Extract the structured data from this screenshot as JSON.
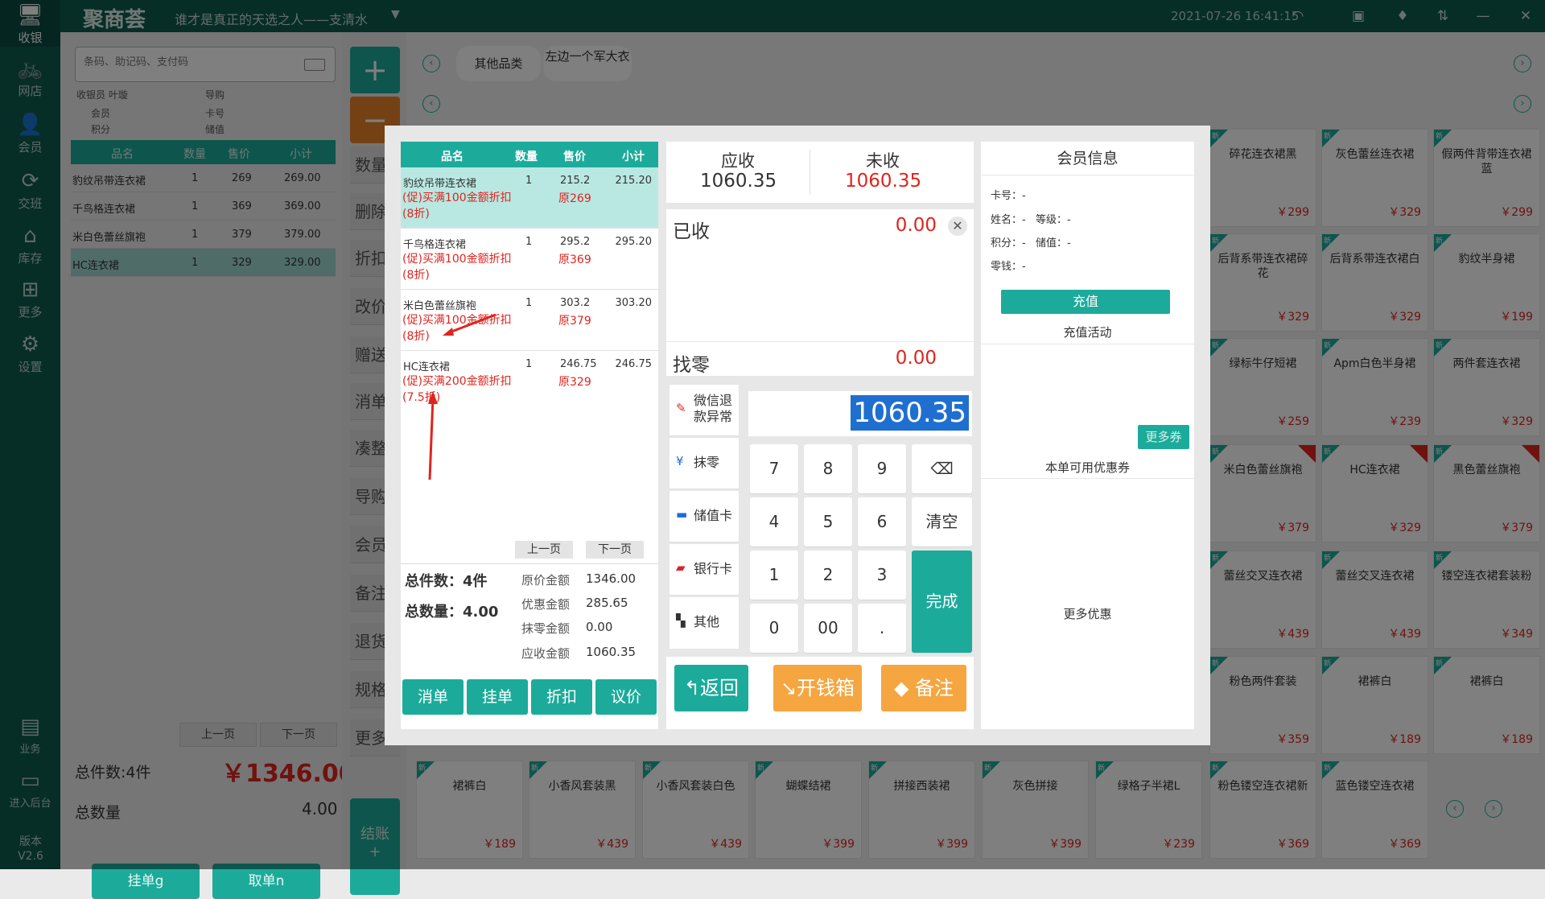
{
  "nav": [
    {
      "icon": "monitor-icon",
      "glyph": "🖥",
      "label": "收银"
    },
    {
      "icon": "bike-icon",
      "glyph": "🚲",
      "label": "网店"
    },
    {
      "icon": "user-icon",
      "glyph": "👤",
      "label": "会员"
    },
    {
      "icon": "exchange-icon",
      "glyph": "⟳",
      "label": "交班"
    },
    {
      "icon": "warehouse-icon",
      "glyph": "⌂",
      "label": "库存"
    },
    {
      "icon": "grid-icon",
      "glyph": "⊞",
      "label": "更多"
    },
    {
      "icon": "gear-icon",
      "glyph": "⚙",
      "label": "设置"
    },
    {
      "icon": "report-icon",
      "glyph": "▤",
      "label": "业务"
    },
    {
      "icon": "backend-icon",
      "glyph": "▭",
      "label": "进入后台"
    },
    {
      "icon": "",
      "glyph": "",
      "label": "版本 V2.6"
    }
  ],
  "topbar": {
    "logo": "聚商荟",
    "slogan": "谁才是真正的天选之人——支清水",
    "datetime": "2021-07-26 16:41:15"
  },
  "left": {
    "search_placeholder": "条码、助记码、支付码",
    "cashier_label": "收银员",
    "cashier": "叶璇",
    "guide_label": "导购",
    "member_label": "会员",
    "card_label": "卡号",
    "points_label": "积分",
    "stored_label": "储值",
    "columns": [
      "品名",
      "数量",
      "售价",
      "小计"
    ],
    "rows": [
      {
        "name": "豹纹吊带连衣裙",
        "qty": "1",
        "price": "269",
        "subtotal": "269.00"
      },
      {
        "name": "千鸟格连衣裙",
        "qty": "1",
        "price": "369",
        "subtotal": "369.00"
      },
      {
        "name": "米白色蕾丝旗袍",
        "qty": "1",
        "price": "379",
        "subtotal": "379.00"
      },
      {
        "name": "HC连衣裙",
        "qty": "1",
        "price": "329",
        "subtotal": "329.00"
      }
    ],
    "prev": "上一页",
    "next": "下一页",
    "total_count": "总件数:4件",
    "total_amount": "￥1346.00",
    "total_qty_label": "总数量",
    "total_qty": "4.00",
    "hold_btn": "挂单g",
    "take_btn": "取单n"
  },
  "mid": {
    "plus": "+",
    "minus": "−",
    "labels": [
      "数量",
      "删除",
      "折扣",
      "改价",
      "赠送",
      "消单",
      "凑整",
      "导购",
      "会员",
      "备注",
      "退货",
      "规格",
      "更多"
    ],
    "settle": "结账",
    "settle_sub": "+"
  },
  "products": {
    "tabs": [
      "其他品类",
      "左边一个军大衣"
    ],
    "row0": [
      {
        "name": "碎花连衣裙黑",
        "price": "￥299",
        "red": false
      },
      {
        "name": "灰色蕾丝连衣裙",
        "price": "￥329",
        "red": false
      },
      {
        "name": "假两件背带连衣裙蓝",
        "price": "￥299",
        "red": false
      }
    ],
    "row1": [
      {
        "name": "后背系带连衣裙碎花",
        "price": "￥329",
        "red": false
      },
      {
        "name": "后背系带连衣裙白",
        "price": "￥329",
        "red": false
      },
      {
        "name": "豹纹半身裙",
        "price": "￥199",
        "red": false
      }
    ],
    "row2": [
      {
        "name": "绿标牛仔短裙",
        "price": "￥259",
        "red": false
      },
      {
        "name": "Apm白色半身裙",
        "price": "￥239",
        "red": false
      },
      {
        "name": "两件套连衣裙",
        "price": "￥329",
        "red": false
      }
    ],
    "row3": [
      {
        "name": "米白色蕾丝旗袍",
        "price": "￥379",
        "red": true
      },
      {
        "name": "HC连衣裙",
        "price": "￥329",
        "red": true
      },
      {
        "name": "黑色蕾丝旗袍",
        "price": "￥379",
        "red": true
      }
    ],
    "row4": [
      {
        "name": "蕾丝交叉连衣裙",
        "price": "￥439",
        "red": false
      },
      {
        "name": "蕾丝交叉连衣裙",
        "price": "￥439",
        "red": false
      },
      {
        "name": "镂空连衣裙套装粉",
        "price": "￥349",
        "red": false
      }
    ],
    "row5": [
      {
        "name": "粉色两件套装",
        "price": "￥359",
        "red": false
      },
      {
        "name": "裙裤白",
        "price": "￥189",
        "red": false
      },
      {
        "name": "裙裤白",
        "price": "￥189",
        "red": false
      }
    ],
    "bottom": [
      {
        "name": "裙裤白",
        "price": "￥189"
      },
      {
        "name": "小香风套装黑",
        "price": "￥439"
      },
      {
        "name": "小香风套装白色",
        "price": "￥439"
      },
      {
        "name": "蝴蝶结裙",
        "price": "￥399"
      },
      {
        "name": "拼接西装裙",
        "price": "￥399"
      },
      {
        "name": "灰色拼接",
        "price": "￥399"
      },
      {
        "name": "绿格子半裙L",
        "price": "￥239"
      },
      {
        "name": "粉色镂空连衣裙新",
        "price": "￥369"
      },
      {
        "name": "蓝色镂空连衣裙",
        "price": "￥369"
      }
    ],
    "new_tag": "新"
  },
  "dialog": {
    "order": {
      "columns": [
        "品名",
        "数量",
        "售价",
        "小计"
      ],
      "items": [
        {
          "name": "豹纹吊带连衣裙",
          "qty": "1",
          "price": "215.2",
          "subtotal": "215.20",
          "promo": "(促)买满100金额折扣 (8折)",
          "orig": "原269"
        },
        {
          "name": "千鸟格连衣裙",
          "qty": "1",
          "price": "295.2",
          "subtotal": "295.20",
          "promo": "(促)买满100金额折扣 (8折)",
          "orig": "原369"
        },
        {
          "name": "米白色蕾丝旗袍",
          "qty": "1",
          "price": "303.2",
          "subtotal": "303.20",
          "promo": "(促)买满100金额折扣 (8折)",
          "orig": "原379"
        },
        {
          "name": "HC连衣裙",
          "qty": "1",
          "price": "246.75",
          "subtotal": "246.75",
          "promo": "(促)买满200金额折扣 (7.5折)",
          "orig": "原329"
        }
      ],
      "prev": "上一页",
      "next": "下一页",
      "total_count": "总件数：4件",
      "total_qty": "总数量：4.00",
      "orig_label": "原价金额",
      "orig_val": "1346.00",
      "disc_label": "优惠金额",
      "disc_val": "285.65",
      "round_label": "抹零金额",
      "round_val": "0.00",
      "due_label": "应收金额",
      "due_val": "1060.35",
      "buttons": [
        "消单",
        "挂单",
        "折扣",
        "议价"
      ]
    },
    "pay": {
      "due_label": "应收",
      "due": "1060.35",
      "unpaid_label": "未收",
      "unpaid": "1060.35",
      "paid_label": "已收",
      "paid": "0.00",
      "change_label": "找零",
      "change": "0.00",
      "methods": [
        {
          "icon": "wechat-refund-icon",
          "glyph": "✎",
          "label": "微信退款异常"
        },
        {
          "icon": "yen-icon",
          "glyph": "¥",
          "label": "抹零"
        },
        {
          "icon": "card-icon",
          "glyph": "▬",
          "label": "储值卡"
        },
        {
          "icon": "unionpay-icon",
          "glyph": "▰",
          "label": "银行卡"
        },
        {
          "icon": "apps-icon",
          "glyph": "▚",
          "label": "其他"
        }
      ],
      "amount": "1060.35",
      "keys": [
        "7",
        "8",
        "9",
        "4",
        "5",
        "6",
        "1",
        "2",
        "3",
        "0",
        "00",
        "."
      ],
      "clear": "清空",
      "done": "完成",
      "back": "返回",
      "drawer": "开钱箱",
      "note": "备注"
    },
    "member": {
      "title": "会员信息",
      "card": "卡号：-",
      "name": "姓名：-",
      "level": "等级：-",
      "points": "积分：-",
      "stored": "储值：-",
      "change": "零钱：-",
      "recharge": "充值",
      "recharge_activity": "充值活动",
      "more_coupon": "更多券",
      "available_coupon": "本单可用优惠券",
      "more_discount": "更多优惠"
    }
  },
  "colors": {
    "primary": "#1cab9b",
    "dark": "#0e5a4e",
    "red": "#e0241e",
    "orange": "#f5a640"
  }
}
